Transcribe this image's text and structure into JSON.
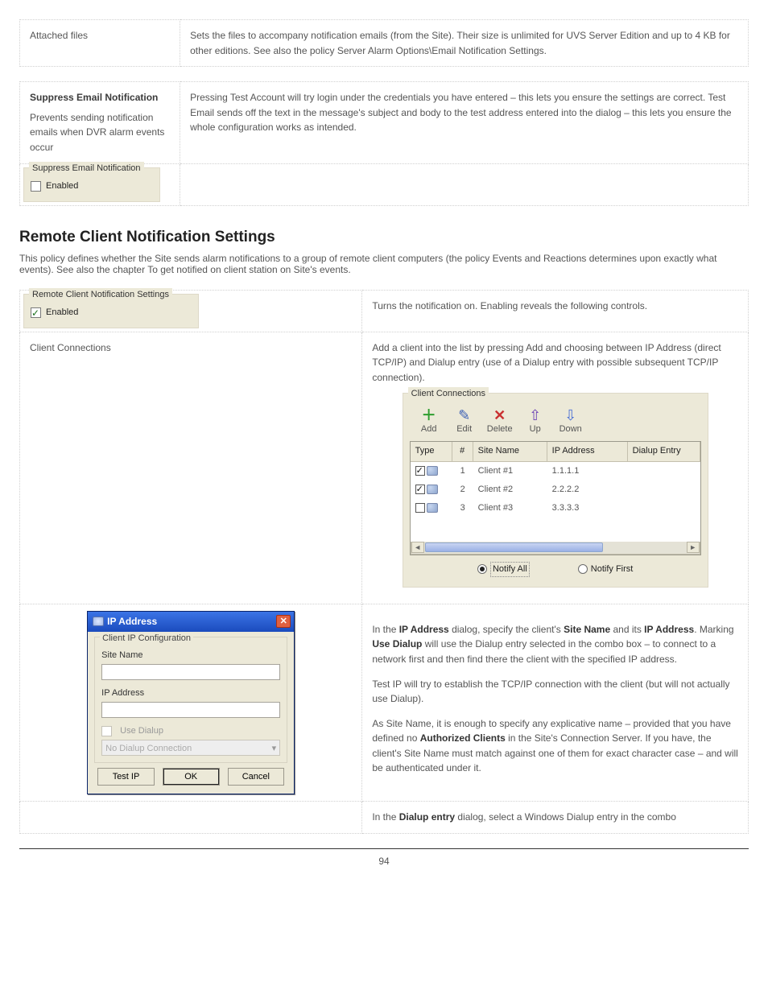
{
  "row1": {
    "left": "Attached files",
    "right": "Sets the files to accompany notification emails (from the Site). Their size is unlimited for UVS Server Edition and up to 4 KB for other editions. See also the policy Server Alarm Options\\Email Notification Settings."
  },
  "row2": {
    "left_title": "Suppress Email Notification",
    "left_text": "Prevents sending notification emails when DVR alarm events occur",
    "right": "Pressing Test Account will try login under the credentials you have entered – this lets you ensure the settings are correct. Test Email sends off the text in the message's subject and body to the test address entered into the dialog – this lets you ensure the whole configuration works as intended."
  },
  "row2b": {
    "chk_label": "Enabled",
    "group_title": "Suppress Email Notification"
  },
  "section": {
    "title": "Remote Client Notification Settings",
    "sub": "This policy defines whether the Site sends alarm notifications to a group of remote client computers (the policy Events and Reactions determines upon exactly what events). See also the chapter To get notified on client station on Site's events."
  },
  "row3": {
    "group_title": "Remote Client Notification Settings",
    "chk_label": "Enabled",
    "right": "Turns the notification on. Enabling reveals the following controls."
  },
  "row4": {
    "left": "Client Connections",
    "right": "Add a client into the list by pressing Add and choosing between IP Address (direct TCP/IP) and Dialup entry (use of a Dialup entry with possible subsequent TCP/IP connection)."
  },
  "cc": {
    "legend": "Client Connections",
    "tools": {
      "add": "Add",
      "edit": "Edit",
      "delete": "Delete",
      "up": "Up",
      "down": "Down"
    },
    "headers": {
      "type": "Type",
      "num": "#",
      "site": "Site Name",
      "ip": "IP Address",
      "dial": "Dialup Entry"
    },
    "rows": [
      {
        "checked": true,
        "num": "1",
        "site": "Client #1",
        "ip": "1.1.1.1",
        "dial": ""
      },
      {
        "checked": true,
        "num": "2",
        "site": "Client #2",
        "ip": "2.2.2.2",
        "dial": ""
      },
      {
        "checked": false,
        "num": "3",
        "site": "Client #3",
        "ip": "3.3.3.3",
        "dial": ""
      }
    ],
    "notify_all": "Notify All",
    "notify_first": "Notify First"
  },
  "dlg": {
    "title": "IP Address",
    "group": "Client IP Configuration",
    "site_label": "Site Name",
    "ip_label": "IP Address",
    "use_dialup": "Use Dialup",
    "combo": "No Dialup Connection",
    "test": "Test IP",
    "ok": "OK",
    "cancel": "Cancel"
  },
  "row5_right": {
    "p1_a": "In the ",
    "p1_b": "IP Address",
    "p1_c": " dialog, specify the client's ",
    "p1_d": "Site Name",
    "p1_e": " and its ",
    "p1_f": "IP Address",
    "p1_g": ". Marking ",
    "p1_h": "Use Dialup",
    "p1_i": " will use the Dialup entry selected in the combo box – to connect to a network first and then find there the client with the specified IP address.",
    "p2": "Test IP will try to establish the TCP/IP connection with the client (but will not actually use Dialup).",
    "p3_a": "As Site Name, it is enough to specify any explicative name – provided that you have defined no ",
    "p3_b": "Authorized Clients",
    "p3_c": " in the Site's Connection Server. If you have, the client's Site Name must match against one of them for exact character case – and will be authenticated under it."
  },
  "row6": {
    "left": "",
    "right_a": "In the ",
    "right_b": "Dialup entry",
    "right_c": " dialog, select a Windows Dialup entry in the combo"
  },
  "page": "94"
}
